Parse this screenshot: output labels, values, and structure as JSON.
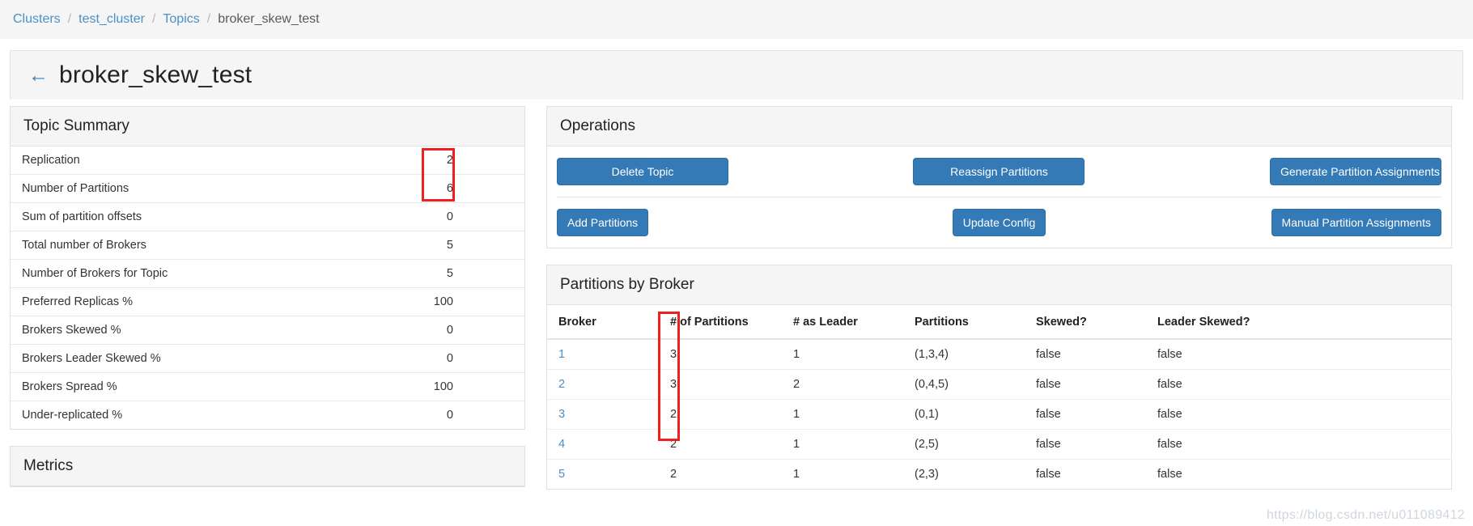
{
  "breadcrumb": {
    "items": [
      {
        "label": "Clusters",
        "link": true
      },
      {
        "label": "test_cluster",
        "link": true
      },
      {
        "label": "Topics",
        "link": true
      },
      {
        "label": "broker_skew_test",
        "link": false
      }
    ],
    "separator": "/"
  },
  "header": {
    "back_icon": "←",
    "title": "broker_skew_test"
  },
  "topic_summary": {
    "title": "Topic Summary",
    "rows": [
      {
        "label": "Replication",
        "value": "2"
      },
      {
        "label": "Number of Partitions",
        "value": "6"
      },
      {
        "label": "Sum of partition offsets",
        "value": "0"
      },
      {
        "label": "Total number of Brokers",
        "value": "5"
      },
      {
        "label": "Number of Brokers for Topic",
        "value": "5"
      },
      {
        "label": "Preferred Replicas %",
        "value": "100"
      },
      {
        "label": "Brokers Skewed %",
        "value": "0"
      },
      {
        "label": "Brokers Leader Skewed %",
        "value": "0"
      },
      {
        "label": "Brokers Spread %",
        "value": "100"
      },
      {
        "label": "Under-replicated %",
        "value": "0"
      }
    ]
  },
  "metrics": {
    "title": "Metrics"
  },
  "operations": {
    "title": "Operations",
    "row1": [
      {
        "label": "Delete Topic"
      },
      {
        "label": "Reassign Partitions"
      },
      {
        "label": "Generate Partition Assignments"
      }
    ],
    "row2": [
      {
        "label": "Add Partitions"
      },
      {
        "label": "Update Config"
      },
      {
        "label": "Manual Partition Assignments"
      }
    ]
  },
  "partitions_by_broker": {
    "title": "Partitions by Broker",
    "columns": [
      "Broker",
      "# of Partitions",
      "# as Leader",
      "Partitions",
      "Skewed?",
      "Leader Skewed?"
    ],
    "rows": [
      {
        "broker": "1",
        "num_partitions": "3",
        "as_leader": "1",
        "partitions": "(1,3,4)",
        "skewed": "false",
        "leader_skewed": "false"
      },
      {
        "broker": "2",
        "num_partitions": "3",
        "as_leader": "2",
        "partitions": "(0,4,5)",
        "skewed": "false",
        "leader_skewed": "false"
      },
      {
        "broker": "3",
        "num_partitions": "2",
        "as_leader": "1",
        "partitions": "(0,1)",
        "skewed": "false",
        "leader_skewed": "false"
      },
      {
        "broker": "4",
        "num_partitions": "2",
        "as_leader": "1",
        "partitions": "(2,5)",
        "skewed": "false",
        "leader_skewed": "false"
      },
      {
        "broker": "5",
        "num_partitions": "2",
        "as_leader": "1",
        "partitions": "(2,3)",
        "skewed": "false",
        "leader_skewed": "false"
      }
    ]
  },
  "annotations": {
    "highlight_color": "#f02020",
    "summary_box_note": "Replication and Number of Partitions values",
    "broker_box_note": "# of Partitions column values"
  },
  "watermark": {
    "text": "https://blog.csdn.net/u011089412"
  },
  "colors": {
    "primary_button": "#337ab7",
    "link": "#4a90c7",
    "panel_header_bg": "#f5f5f5"
  }
}
